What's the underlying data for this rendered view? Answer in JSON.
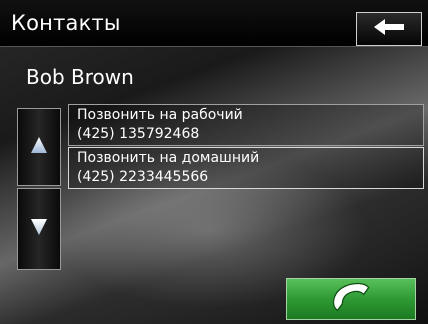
{
  "header": {
    "title": "Контакты",
    "back_icon": "arrow-left-icon"
  },
  "contact": {
    "name": "Bob Brown"
  },
  "scroll": {
    "up_icon": "triangle-up-icon",
    "down_icon": "triangle-down-icon"
  },
  "actions": [
    {
      "label": "Позвонить на рабочий",
      "number": "(425) 135792468"
    },
    {
      "label": "Позвонить на домашний",
      "number": "(425) 2233445566"
    }
  ],
  "call_button": {
    "icon": "phone-handset-icon",
    "color": "#3aa83e"
  }
}
